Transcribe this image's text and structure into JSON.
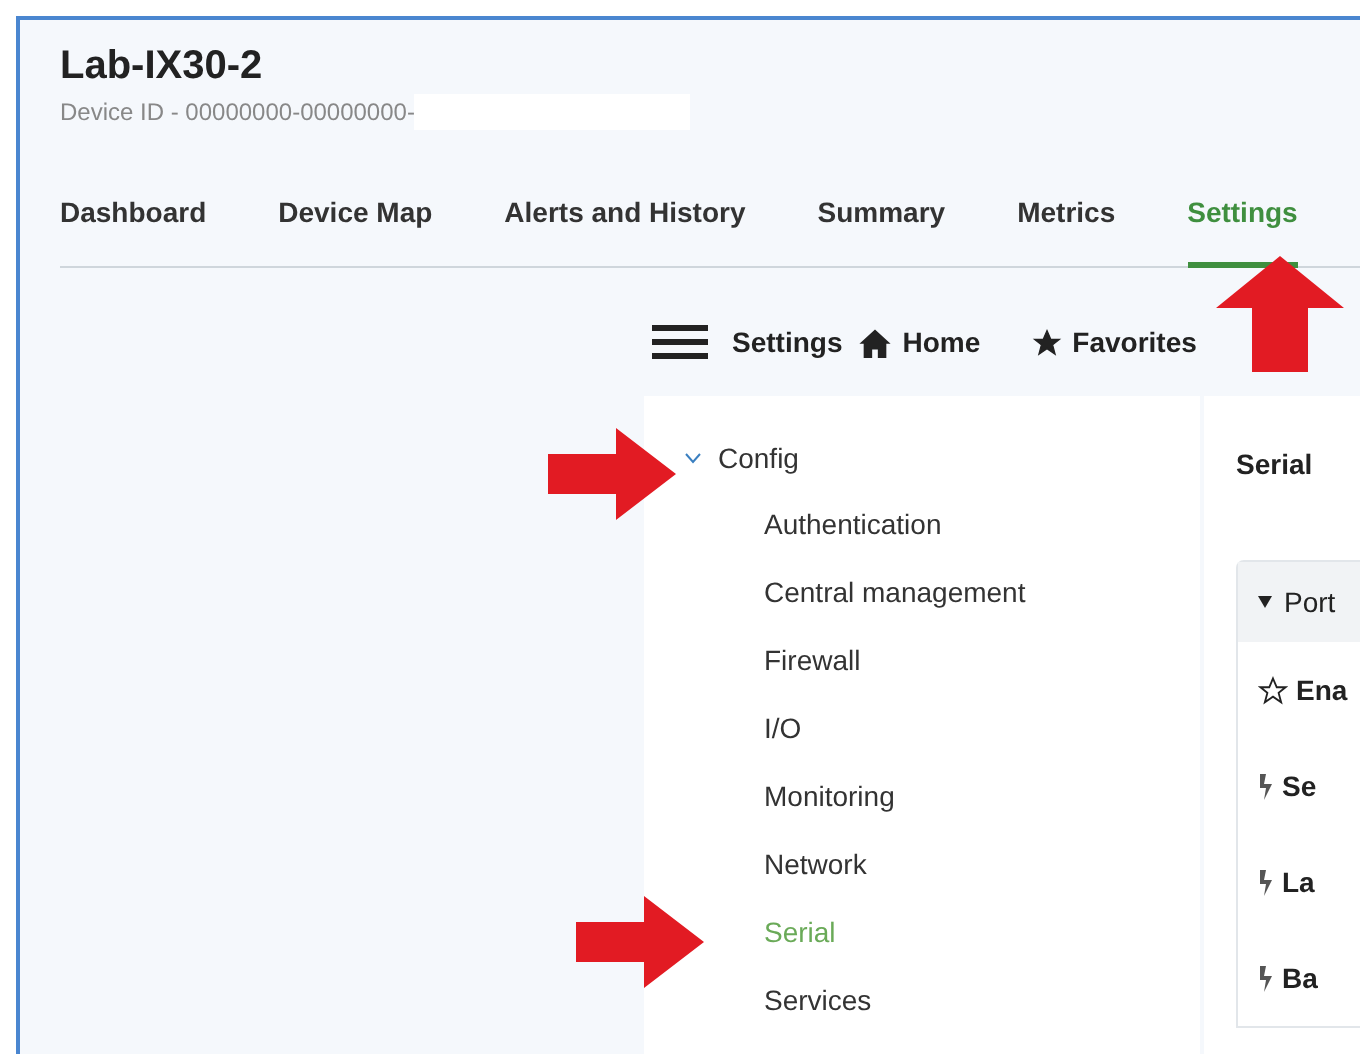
{
  "device": {
    "name": "Lab-IX30-2",
    "device_id": "Device ID - 00000000-00000000-"
  },
  "tabs": [
    {
      "label": "Dashboard",
      "selected": false
    },
    {
      "label": "Device Map",
      "selected": false
    },
    {
      "label": "Alerts and History",
      "selected": false
    },
    {
      "label": "Summary",
      "selected": false
    },
    {
      "label": "Metrics",
      "selected": false
    },
    {
      "label": "Settings",
      "selected": true
    }
  ],
  "toolbar": {
    "menu_label": "Settings",
    "home": "Home",
    "favorites": "Favorites"
  },
  "tree": [
    {
      "label": "Config",
      "expanded": true,
      "children": [
        {
          "label": "Authentication",
          "selected": false
        },
        {
          "label": "Central management",
          "selected": false
        },
        {
          "label": "Firewall",
          "selected": false
        },
        {
          "label": "I/O",
          "selected": false
        },
        {
          "label": "Monitoring",
          "selected": false
        },
        {
          "label": "Network",
          "selected": false
        },
        {
          "label": "Serial",
          "selected": true
        },
        {
          "label": "Services",
          "selected": false
        }
      ]
    }
  ],
  "panel": {
    "title": "Serial",
    "section": {
      "label": "Port",
      "expanded": true,
      "rows": [
        {
          "kind": "favorite",
          "label": "Ena"
        },
        {
          "kind": "action",
          "label": "Se"
        },
        {
          "kind": "action",
          "label": "La"
        },
        {
          "kind": "action",
          "label": "Ba"
        }
      ]
    }
  }
}
